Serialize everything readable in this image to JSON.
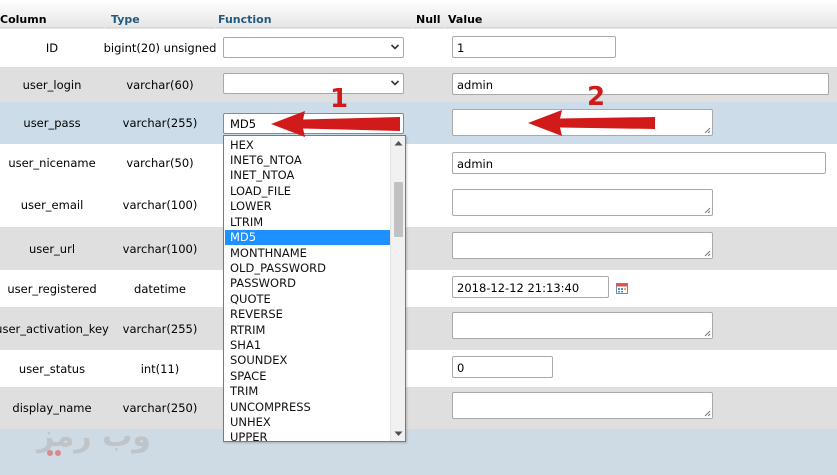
{
  "header": {
    "column": "Column",
    "type": "Type",
    "function": "Function",
    "null": "Null",
    "value": "Value"
  },
  "rows": [
    {
      "column": "ID",
      "type": "bigint(20) unsigned",
      "function": "",
      "value": "1"
    },
    {
      "column": "user_login",
      "type": "varchar(60)",
      "function": "",
      "value": "admin"
    },
    {
      "column": "user_pass",
      "type": "varchar(255)",
      "function": "MD5",
      "value": ""
    },
    {
      "column": "user_nicename",
      "type": "varchar(50)",
      "function": "",
      "value": "admin"
    },
    {
      "column": "user_email",
      "type": "varchar(100)",
      "function": "",
      "value": ""
    },
    {
      "column": "user_url",
      "type": "varchar(100)",
      "function": "",
      "value": ""
    },
    {
      "column": "user_registered",
      "type": "datetime",
      "function": "",
      "value": "2018-12-12 21:13:40"
    },
    {
      "column": "user_activation_key",
      "type": "varchar(255)",
      "function": "",
      "value": ""
    },
    {
      "column": "user_status",
      "type": "int(11)",
      "function": "",
      "value": "0"
    },
    {
      "column": "display_name",
      "type": "varchar(250)",
      "function": "",
      "value": ""
    }
  ],
  "dropdown": {
    "selected": "MD5",
    "options": [
      "HEX",
      "INET6_NTOA",
      "INET_NTOA",
      "LOAD_FILE",
      "LOWER",
      "LTRIM",
      "MD5",
      "MONTHNAME",
      "OLD_PASSWORD",
      "PASSWORD",
      "QUOTE",
      "REVERSE",
      "RTRIM",
      "SHA1",
      "SOUNDEX",
      "SPACE",
      "TRIM",
      "UNCOMPRESS",
      "UNHEX",
      "UPPER"
    ]
  },
  "annotations": {
    "marker_1": "1",
    "marker_2": "2",
    "color": "#d11a1a"
  },
  "watermark": {
    "text": "وب رمز"
  },
  "icons": {
    "calendar": "calendar-icon",
    "select_arrow": "chevron-down-icon"
  },
  "colors": {
    "header_link": "#235a81",
    "row_even": "#dfdfdf",
    "row_selected": "#ccdde9",
    "highlight": "#1e90ff"
  }
}
